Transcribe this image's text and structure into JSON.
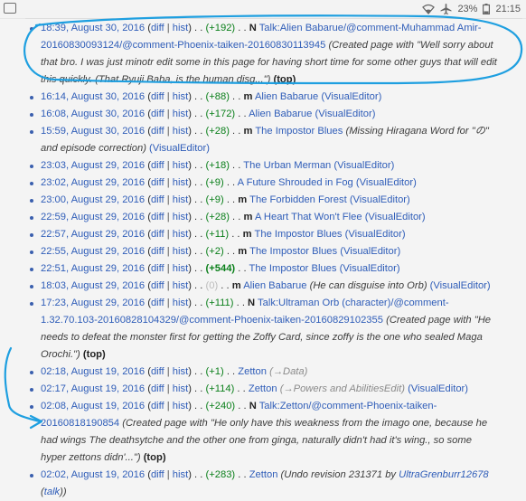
{
  "status_bar": {
    "battery": "23%",
    "time": "21:15",
    "icons": [
      "notification-icon",
      "wifi-icon",
      "airplane-icon",
      "battery-icon"
    ]
  },
  "entries": [
    {
      "time": "18:39, August 30, 2016",
      "diff": "diff",
      "hist": "hist",
      "delta": "(+192)",
      "delta_type": "pos",
      "flag": "N",
      "title": "Talk:Alien Babarue/@comment-Muhammad Amir-20160830093124/@comment-Phoenix-taiken-20160830113945",
      "comment": "(Created page with \"Well sorry about that bro. I was just minotr edit some in this page for having short time for some other guys that will edit this quickly. (That Ryuji Baba, is the human disg...\")",
      "top": "(top)"
    },
    {
      "time": "16:14, August 30, 2016",
      "diff": "diff",
      "hist": "hist",
      "delta": "(+88)",
      "delta_type": "pos",
      "flag": "m",
      "title": "Alien Babarue",
      "tag": "(VisualEditor)"
    },
    {
      "time": "16:08, August 30, 2016",
      "diff": "diff",
      "hist": "hist",
      "delta": "(+172)",
      "delta_type": "pos",
      "title": "Alien Babarue",
      "tag": "(VisualEditor)"
    },
    {
      "time": "15:59, August 30, 2016",
      "diff": "diff",
      "hist": "hist",
      "delta": "(+28)",
      "delta_type": "pos",
      "flag": "m",
      "title": "The Impostor Blues",
      "comment": "(Missing Hiragana Word for \"の\" and episode correction)",
      "tag": "(VisualEditor)"
    },
    {
      "time": "23:03, August 29, 2016",
      "diff": "diff",
      "hist": "hist",
      "delta": "(+18)",
      "delta_type": "pos",
      "title": "The Urban Merman",
      "tag": "(VisualEditor)"
    },
    {
      "time": "23:02, August 29, 2016",
      "diff": "diff",
      "hist": "hist",
      "delta": "(+9)",
      "delta_type": "pos",
      "title": "A Future Shrouded in Fog",
      "tag": "(VisualEditor)"
    },
    {
      "time": "23:00, August 29, 2016",
      "diff": "diff",
      "hist": "hist",
      "delta": "(+9)",
      "delta_type": "pos",
      "flag": "m",
      "title": "The Forbidden Forest",
      "tag": "(VisualEditor)"
    },
    {
      "time": "22:59, August 29, 2016",
      "diff": "diff",
      "hist": "hist",
      "delta": "(+28)",
      "delta_type": "pos",
      "flag": "m",
      "title": "A Heart That Won't Flee",
      "tag": "(VisualEditor)"
    },
    {
      "time": "22:57, August 29, 2016",
      "diff": "diff",
      "hist": "hist",
      "delta": "(+11)",
      "delta_type": "pos",
      "flag": "m",
      "title": "The Impostor Blues",
      "tag": "(VisualEditor)"
    },
    {
      "time": "22:55, August 29, 2016",
      "diff": "diff",
      "hist": "hist",
      "delta": "(+2)",
      "delta_type": "pos",
      "flag": "m",
      "title": "The Impostor Blues",
      "tag": "(VisualEditor)"
    },
    {
      "time": "22:51, August 29, 2016",
      "diff": "diff",
      "hist": "hist",
      "delta": "(+544)",
      "delta_type": "pos big",
      "title": "The Impostor Blues",
      "tag": "(VisualEditor)"
    },
    {
      "time": "18:03, August 29, 2016",
      "diff": "diff",
      "hist": "hist",
      "delta": "(0)",
      "delta_type": "zero",
      "flag": "m",
      "title": "Alien Babarue",
      "comment": "(He can disguise into Orb)",
      "tag": "(VisualEditor)"
    },
    {
      "time": "17:23, August 29, 2016",
      "diff": "diff",
      "hist": "hist",
      "delta": "(+111)",
      "delta_type": "pos",
      "flag": "N",
      "title": "Talk:Ultraman Orb (character)/@comment-1.32.70.103-20160828104329/@comment-Phoenix-taiken-20160829102355",
      "comment": "(Created page with \"He needs to defeat the monster first for getting the Zoffy Card, since zoffy is the one who sealed Maga Orochi.\")",
      "top": "(top)"
    },
    {
      "time": "02:18, August 19, 2016",
      "diff": "diff",
      "hist": "hist",
      "delta": "(+1)",
      "delta_type": "pos",
      "title": "Zetton",
      "section": "(→Data)"
    },
    {
      "time": "02:17, August 19, 2016",
      "diff": "diff",
      "hist": "hist",
      "delta": "(+114)",
      "delta_type": "pos",
      "title": "Zetton",
      "section": "(→Powers and AbilitiesEdit)",
      "tag": "(VisualEditor)"
    },
    {
      "time": "02:08, August 19, 2016",
      "diff": "diff",
      "hist": "hist",
      "delta": "(+240)",
      "delta_type": "pos",
      "flag": "N",
      "title": "Talk:Zetton/@comment-Phoenix-taiken-20160818190854",
      "comment": "(Created page with \"He only have this weakness from the imago one, because he had wings The deathsytche and the other one from ginga, naturally didn't had it's wing., so some hyper zettons didn'...\")",
      "top": "(top)"
    },
    {
      "time": "02:02, August 19, 2016",
      "diff": "diff",
      "hist": "hist",
      "delta": "(+283)",
      "delta_type": "pos",
      "title": "Zetton",
      "comment_prefix": "(Undo revision 231371 by ",
      "comment_user": "UltraGrenburr12678",
      "comment_mid": " (",
      "comment_talk": "talk",
      "comment_suffix": "))"
    }
  ]
}
